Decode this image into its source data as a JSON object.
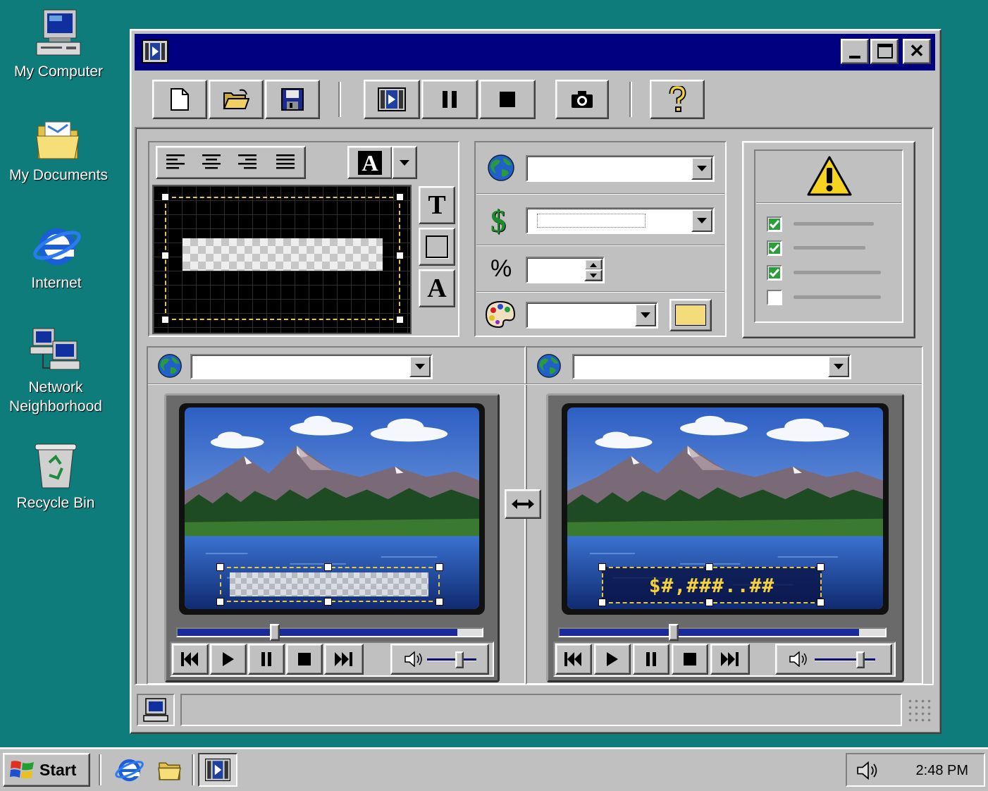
{
  "desktop": {
    "icons": [
      {
        "label": "My Computer",
        "icon": "my-computer-icon"
      },
      {
        "label": "My Documents",
        "icon": "folder-icon"
      },
      {
        "label": "Internet",
        "icon": "internet-explorer-icon"
      },
      {
        "label": "Network Neighborhood",
        "icon": "network-icon"
      },
      {
        "label": "Recycle Bin",
        "icon": "recycle-bin-icon"
      }
    ]
  },
  "window": {
    "title": "",
    "title_icon": "film-icon",
    "controls": [
      "minimize-icon",
      "maximize-icon",
      "close-icon"
    ]
  },
  "toolbar": [
    "new-document-icon",
    "open-folder-icon",
    "save-icon",
    "video-icon",
    "pause-icon",
    "stop-icon",
    "camera-icon",
    "help-icon"
  ],
  "text_editor": {
    "align_buttons": [
      "align-left-icon",
      "align-center-icon",
      "align-right-icon",
      "justify-icon"
    ],
    "font_button_label": "A",
    "tools": [
      {
        "label": "T",
        "icon": "text-tool-icon"
      },
      {
        "label": "",
        "icon": "rectangle-tool-icon"
      },
      {
        "label": "A",
        "icon": "font-tool-icon"
      }
    ]
  },
  "settings": {
    "language_value": "",
    "currency_symbol": "$",
    "currency_value": "",
    "percent_symbol": "%",
    "percent_value": "",
    "color_value": "",
    "color_swatch": "#f5dc7a"
  },
  "checklist": {
    "items": [
      {
        "checked": true
      },
      {
        "checked": true
      },
      {
        "checked": true
      },
      {
        "checked": false
      }
    ]
  },
  "preview_left": {
    "url": "",
    "progress": 0.32,
    "volume": 0.65
  },
  "preview_right": {
    "url": "",
    "overlay_text": "$#,###..##",
    "progress": 0.35,
    "volume": 0.75
  },
  "swap_icon": "swap-arrows-icon",
  "status_bar": {
    "text": ""
  },
  "taskbar": {
    "start_label": "Start",
    "quick_launch": [
      "internet-explorer-icon",
      "folder-icon"
    ],
    "active_app_icon": "film-icon",
    "clock": "2:48 PM"
  },
  "colors": {
    "desktop": "#0e7c7b",
    "titlebar": "#000080",
    "face": "#c0c0c0",
    "overlay_text": "#f5d13a"
  }
}
